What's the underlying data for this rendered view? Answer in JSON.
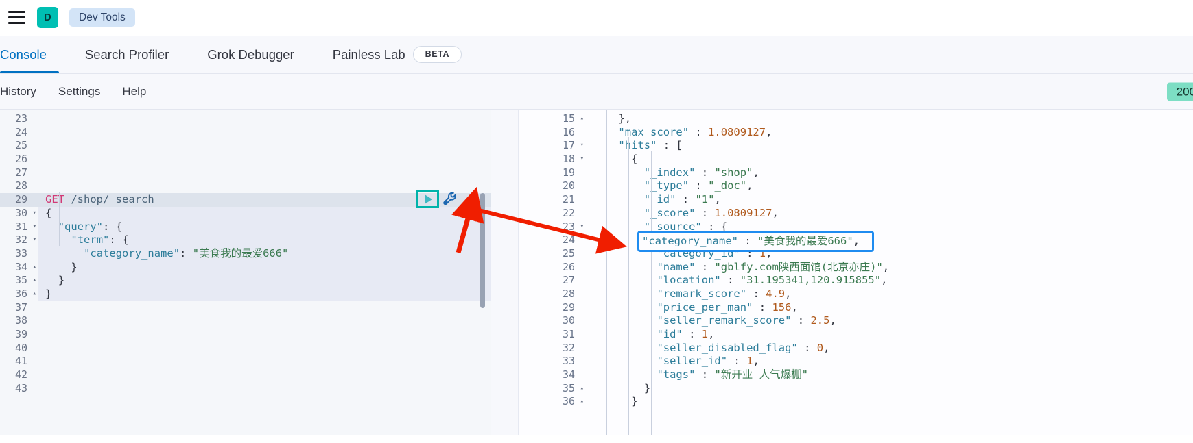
{
  "chrome": {
    "menu_icon": "hamburger-icon",
    "space_initial": "D",
    "breadcrumb": "Dev Tools"
  },
  "tabs": [
    {
      "label": "Console",
      "active": true,
      "badge": null
    },
    {
      "label": "Search Profiler",
      "active": false,
      "badge": null
    },
    {
      "label": "Grok Debugger",
      "active": false,
      "badge": null
    },
    {
      "label": "Painless Lab",
      "active": false,
      "badge": "BETA"
    }
  ],
  "menu": {
    "items": [
      "History",
      "Settings",
      "Help"
    ],
    "status": "200"
  },
  "editor": {
    "first_line": 23,
    "active_line": 29,
    "play_icon": "play-icon",
    "wrench_icon": "wrench-icon",
    "lines": [
      {
        "n": 23,
        "text": "",
        "fold": ""
      },
      {
        "n": 24,
        "text": "",
        "fold": ""
      },
      {
        "n": 25,
        "text": "",
        "fold": ""
      },
      {
        "n": 26,
        "text": "",
        "fold": ""
      },
      {
        "n": 27,
        "text": "",
        "fold": ""
      },
      {
        "n": 28,
        "text": "",
        "fold": ""
      },
      {
        "n": 29,
        "text": "GET /shop/_search",
        "fold": ""
      },
      {
        "n": 30,
        "text": "{",
        "fold": "▾"
      },
      {
        "n": 31,
        "text": "  \"query\": {",
        "fold": "▾"
      },
      {
        "n": 32,
        "text": "    \"term\": {",
        "fold": "▾"
      },
      {
        "n": 33,
        "text": "      \"category_name\": \"美食我的最爱666\"",
        "fold": ""
      },
      {
        "n": 34,
        "text": "    }",
        "fold": "▴"
      },
      {
        "n": 35,
        "text": "  }",
        "fold": "▴"
      },
      {
        "n": 36,
        "text": "}",
        "fold": "▴"
      },
      {
        "n": 37,
        "text": "",
        "fold": ""
      },
      {
        "n": 38,
        "text": "",
        "fold": ""
      },
      {
        "n": 39,
        "text": "",
        "fold": ""
      },
      {
        "n": 40,
        "text": "",
        "fold": ""
      },
      {
        "n": 41,
        "text": "",
        "fold": ""
      },
      {
        "n": 42,
        "text": "",
        "fold": ""
      },
      {
        "n": 43,
        "text": "",
        "fold": ""
      }
    ]
  },
  "response": {
    "first_line": 15,
    "lines": [
      {
        "n": 15,
        "text": "    },",
        "fold": "▴"
      },
      {
        "n": 16,
        "text": "    \"max_score\" : 1.0809127,",
        "fold": ""
      },
      {
        "n": 17,
        "text": "    \"hits\" : [",
        "fold": "▾"
      },
      {
        "n": 18,
        "text": "      {",
        "fold": "▾"
      },
      {
        "n": 19,
        "text": "        \"_index\" : \"shop\",",
        "fold": ""
      },
      {
        "n": 20,
        "text": "        \"_type\" : \"_doc\",",
        "fold": ""
      },
      {
        "n": 21,
        "text": "        \"_id\" : \"1\",",
        "fold": ""
      },
      {
        "n": 22,
        "text": "        \"_score\" : 1.0809127,",
        "fold": ""
      },
      {
        "n": 23,
        "text": "        \"_source\" : {",
        "fold": "▾"
      },
      {
        "n": 24,
        "text": "          \"category_name\" : \"美食我的最爱666\",",
        "fold": ""
      },
      {
        "n": 25,
        "text": "          \"category_id\" : 1,",
        "fold": ""
      },
      {
        "n": 26,
        "text": "          \"name\" : \"gblfy.com陕西面馆(北京亦庄)\",",
        "fold": ""
      },
      {
        "n": 27,
        "text": "          \"location\" : \"31.195341,120.915855\",",
        "fold": ""
      },
      {
        "n": 28,
        "text": "          \"remark_score\" : 4.9,",
        "fold": ""
      },
      {
        "n": 29,
        "text": "          \"price_per_man\" : 156,",
        "fold": ""
      },
      {
        "n": 30,
        "text": "          \"seller_remark_score\" : 2.5,",
        "fold": ""
      },
      {
        "n": 31,
        "text": "          \"id\" : 1,",
        "fold": ""
      },
      {
        "n": 32,
        "text": "          \"seller_disabled_flag\" : 0,",
        "fold": ""
      },
      {
        "n": 33,
        "text": "          \"seller_id\" : 1,",
        "fold": ""
      },
      {
        "n": 34,
        "text": "          \"tags\" : \"新开业 人气爆棚\"",
        "fold": ""
      },
      {
        "n": 35,
        "text": "        }",
        "fold": "▴"
      },
      {
        "n": 36,
        "text": "      }",
        "fold": "▴"
      }
    ]
  },
  "annotation": {
    "highlight_color": "#1f8cf0",
    "arrow_color": "#f01e00",
    "highlighted_text": "\"category_name\" : \"美食我的最爱666\",",
    "target_note": "play-button-to-category-name"
  },
  "colors": {
    "accent": "#0071c2",
    "space_avatar": "#00bfb3",
    "status_badge": "#7ddec4",
    "breadcrumb_pill": "#d3e4f7",
    "play_outline": "#00b3aa"
  }
}
